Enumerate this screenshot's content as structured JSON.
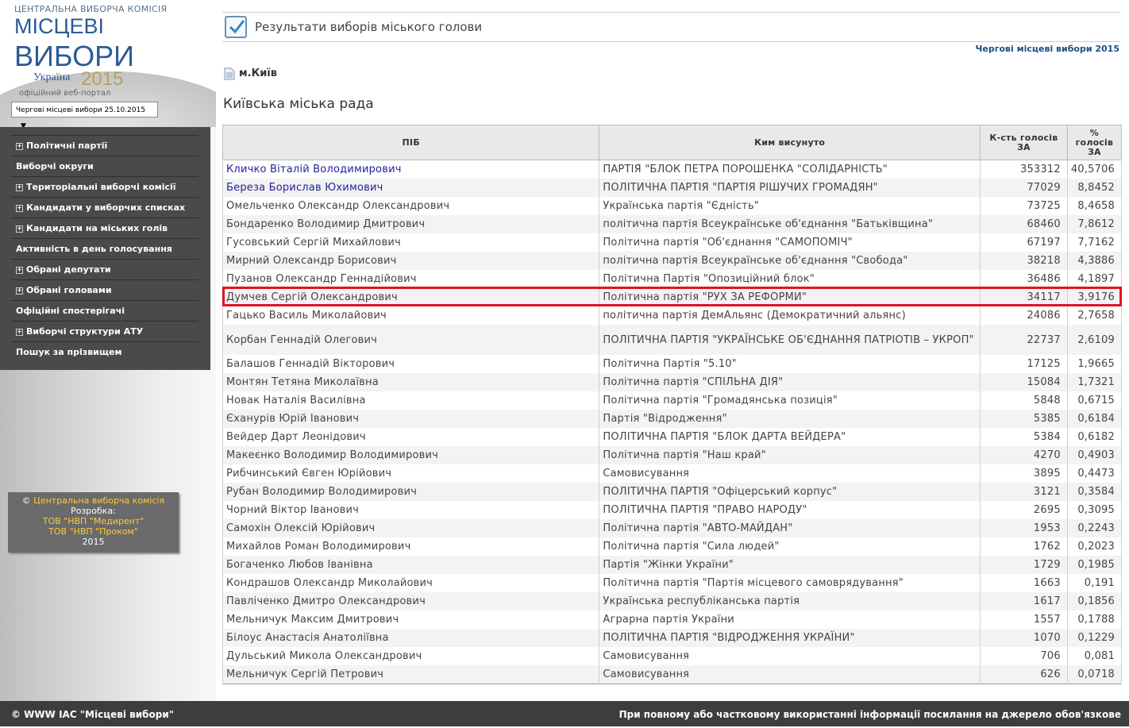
{
  "logo": {
    "commission": "ЦЕНТРАЛЬНА ВИБОРЧА КОМІСІЯ",
    "line1": "МІСЦЕВІ",
    "line2": "ВИБОРИ",
    "country": "Україна",
    "year": "2015",
    "portal": "офіційний веб-портал"
  },
  "election_select": {
    "value": "Чергові місцеві вибори 25.10.2015"
  },
  "menu": [
    {
      "label": "Політичні партії",
      "expandable": true
    },
    {
      "label": "Виборчі округи",
      "expandable": false
    },
    {
      "label": "Територіальні виборчі комісії",
      "expandable": true
    },
    {
      "label": "Кандидати у виборчих списках",
      "expandable": true
    },
    {
      "label": "Кандидати на міських голів",
      "expandable": true
    },
    {
      "label": "Активність в день голосування",
      "expandable": false
    },
    {
      "label": "Обрані депутати",
      "expandable": true
    },
    {
      "label": "Обрані головами",
      "expandable": true
    },
    {
      "label": "Офіційні спостерігачі",
      "expandable": false
    },
    {
      "label": "Виборчі структури АТУ",
      "expandable": true
    },
    {
      "label": "Пошук за прізвищем",
      "expandable": false
    }
  ],
  "copyright": {
    "symbol": "©",
    "org": "Центральна виборча комісія",
    "dev_label": "Розробка:",
    "dev1": "ТОВ \"НВП \"Медирент\"",
    "dev2": "ТОВ \"НВП \"Проком\"",
    "year": "2015"
  },
  "header": {
    "title": "Результати виборів міського голови",
    "election_link": "Чергові місцеві вибори 2015"
  },
  "city": "м.Київ",
  "council": "Київська міська рада",
  "table": {
    "columns": [
      "ПІБ",
      "Ким висунуто",
      "К-сть голосів ЗА",
      "% голосів ЗА"
    ],
    "rows": [
      {
        "name": "Кличко Віталій Володимирович",
        "party": "ПАРТІЯ \"БЛОК ПЕТРА ПОРОШЕНКА \"СОЛІДАРНІСТЬ\"",
        "votes": "353312",
        "pct": "40,5706",
        "elected": true
      },
      {
        "name": "Береза Борислав Юхимович",
        "party": "ПОЛІТИЧНА ПАРТІЯ \"ПАРТІЯ РІШУЧИХ ГРОМАДЯН\"",
        "votes": "77029",
        "pct": "8,8452",
        "elected": true
      },
      {
        "name": "Омельченко Олександр Олександрович",
        "party": "Українська партія \"Єдність\"",
        "votes": "73725",
        "pct": "8,4658"
      },
      {
        "name": "Бондаренко Володимир Дмитрович",
        "party": "політична партія Всеукраїнське об'єднання \"Батьківщина\"",
        "votes": "68460",
        "pct": "7,8612"
      },
      {
        "name": "Гусовський Сергій Михайлович",
        "party": "Політична партія \"Об'єднання \"САМОПОМІЧ\"",
        "votes": "67197",
        "pct": "7,7162"
      },
      {
        "name": "Мирний Олександр Борисович",
        "party": "політична партія Всеукраїнське об'єднання \"Свобода\"",
        "votes": "38218",
        "pct": "4,3886"
      },
      {
        "name": "Пузанов Олександр Геннадійович",
        "party": "Політична Партія \"Опозиційний блок\"",
        "votes": "36486",
        "pct": "4,1897"
      },
      {
        "name": "Думчев Сергій Олександрович",
        "party": "Політична партія \"РУХ ЗА РЕФОРМИ\"",
        "votes": "34117",
        "pct": "3,9176"
      },
      {
        "name": "Гацько Василь Миколайович",
        "party": "політична партія ДемАльянс (Демократичний альянс)",
        "votes": "24086",
        "pct": "2,7658"
      },
      {
        "name": "Корбан Геннадій Олегович",
        "party": "ПОЛІТИЧНА ПАРТІЯ \"УКРАЇНСЬКЕ ОБ'ЄДНАННЯ ПАТРІОТІВ – УКРОП\"",
        "votes": "22737",
        "pct": "2,6109",
        "wrap": true
      },
      {
        "name": "Балашов Геннадій Вікторович",
        "party": "Політична Партія \"5.10\"",
        "votes": "17125",
        "pct": "1,9665"
      },
      {
        "name": "Монтян Тетяна Миколаївна",
        "party": "Політична партія \"СПІЛЬНА ДІЯ\"",
        "votes": "15084",
        "pct": "1,7321"
      },
      {
        "name": "Новак Наталія Василівна",
        "party": "Політична партія \"Громадянська позиція\"",
        "votes": "5848",
        "pct": "0,6715"
      },
      {
        "name": "Єханурів Юрій Іванович",
        "party": "Партія \"Відродження\"",
        "votes": "5385",
        "pct": "0,6184"
      },
      {
        "name": "Вейдер Дарт Леонідович",
        "party": "ПОЛІТИЧНА ПАРТІЯ \"БЛОК ДАРТА ВЕЙДЕРА\"",
        "votes": "5384",
        "pct": "0,6182"
      },
      {
        "name": "Макеєнко Володимир Володимирович",
        "party": "Політична партія \"Наш край\"",
        "votes": "4270",
        "pct": "0,4903"
      },
      {
        "name": "Рибчинський Євген Юрійович",
        "party": "Самовисування",
        "votes": "3895",
        "pct": "0,4473"
      },
      {
        "name": "Рубан Володимир Володимирович",
        "party": "ПОЛІТИЧНА ПАРТІЯ \"Офіцерський корпус\"",
        "votes": "3121",
        "pct": "0,3584"
      },
      {
        "name": "Чорний Віктор Іванович",
        "party": "ПОЛІТИЧНА ПАРТІЯ \"ПРАВО НАРОДУ\"",
        "votes": "2695",
        "pct": "0,3095"
      },
      {
        "name": "Самохін Олексій Юрійович",
        "party": "Політична партія \"АВТО-МАЙДАН\"",
        "votes": "1953",
        "pct": "0,2243"
      },
      {
        "name": "Михайлов Роман Володимирович",
        "party": "Політична партія \"Сила людей\"",
        "votes": "1762",
        "pct": "0,2023"
      },
      {
        "name": "Богаченко Любов Іванівна",
        "party": "Партія \"Жінки України\"",
        "votes": "1729",
        "pct": "0,1985"
      },
      {
        "name": "Кондрашов Олександр Миколайович",
        "party": "Політична партія \"Партія місцевого самоврядування\"",
        "votes": "1663",
        "pct": "0,191"
      },
      {
        "name": "Павліченко Дмитро Олександрович",
        "party": "Українська республіканська партія",
        "votes": "1617",
        "pct": "0,1856"
      },
      {
        "name": "Мельничук Максим Дмитрович",
        "party": "Аграрна партія України",
        "votes": "1557",
        "pct": "0,1788"
      },
      {
        "name": "Білоус Анастасія Анатоліївна",
        "party": "ПОЛІТИЧНА ПАРТІЯ \"ВІДРОДЖЕННЯ УКРАЇНИ\"",
        "votes": "1070",
        "pct": "0,1229"
      },
      {
        "name": "Дульський Микола Олександрович",
        "party": "Самовисування",
        "votes": "706",
        "pct": "0,081"
      },
      {
        "name": "Мельничук Сергій Петрович",
        "party": "Самовисування",
        "votes": "626",
        "pct": "0,0718"
      }
    ]
  },
  "footer": {
    "left": "© WWW ІАС \"Місцеві вибори\"",
    "right": "При повному або частковому використанні інформації посилання на джерело обов'язкове"
  },
  "colors": {
    "menu_bg": "#4a4a4a",
    "highlight": "#e0141e",
    "elected_link": "#22229c",
    "footer_bg": "#3d3d3d"
  }
}
